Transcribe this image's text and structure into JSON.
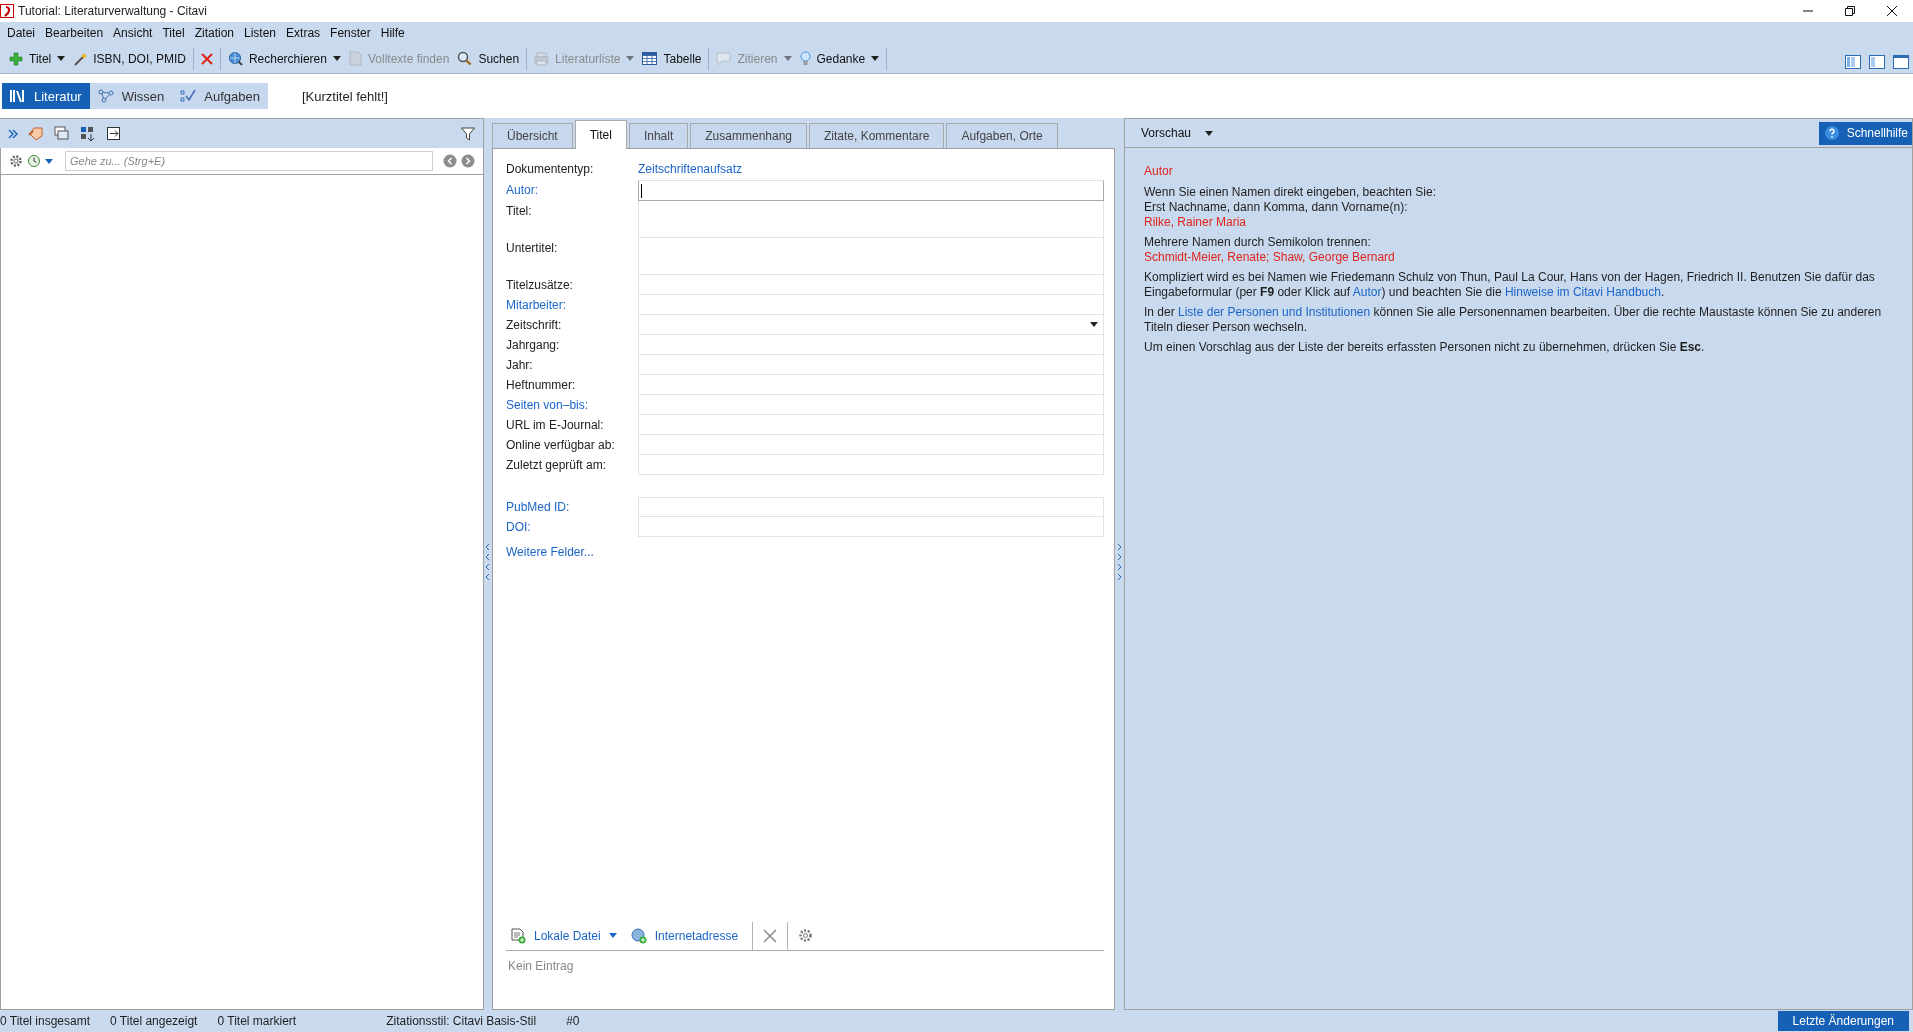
{
  "window": {
    "title": "Tutorial: Literaturverwaltung - Citavi"
  },
  "menu": [
    "Datei",
    "Bearbeiten",
    "Ansicht",
    "Titel",
    "Zitation",
    "Listen",
    "Extras",
    "Fenster",
    "Hilfe"
  ],
  "toolbar": {
    "groups": [
      [
        {
          "label": "Titel",
          "kind": "dropdown",
          "disabled": false
        },
        {
          "label": "ISBN, DOI, PMID",
          "kind": "button",
          "disabled": false
        }
      ],
      [
        {
          "kind": "icon",
          "disabled": false
        }
      ],
      [
        {
          "label": "Recherchieren",
          "kind": "dropdown",
          "disabled": false
        },
        {
          "label": "Volltexte finden",
          "kind": "button",
          "disabled": true
        },
        {
          "label": "Suchen",
          "kind": "button",
          "disabled": false
        }
      ],
      [
        {
          "label": "Literaturliste",
          "kind": "dropdown",
          "disabled": true
        },
        {
          "label": "Tabelle",
          "kind": "button",
          "disabled": false
        }
      ],
      [
        {
          "label": "Zitieren",
          "kind": "dropdown",
          "disabled": true
        },
        {
          "label": "Gedanke",
          "kind": "dropdown",
          "disabled": false
        }
      ]
    ]
  },
  "modes": [
    {
      "label": "Literatur",
      "selected": true
    },
    {
      "label": "Wissen",
      "selected": false
    },
    {
      "label": "Aufgaben",
      "selected": false
    }
  ],
  "short_title": "[Kurztitel fehlt!]",
  "left_pane": {
    "search": {
      "placeholder": "Gehe zu... (Strg+E)"
    }
  },
  "tabs": [
    {
      "label": "Übersicht",
      "selected": false
    },
    {
      "label": "Titel",
      "selected": true
    },
    {
      "label": "Inhalt",
      "selected": false
    },
    {
      "label": "Zusammenhang",
      "selected": false
    },
    {
      "label": "Zitate, Kommentare",
      "selected": false
    },
    {
      "label": "Aufgaben, Orte",
      "selected": false
    }
  ],
  "form": {
    "document_type": {
      "label": "Dokumententyp:",
      "value": "Zeitschriftenaufsatz"
    },
    "fields": [
      {
        "label": "Autor:",
        "link": true,
        "kind": "text",
        "focused": true
      },
      {
        "label": "Titel:",
        "link": false,
        "kind": "multiline",
        "focused": false
      },
      {
        "label": "Untertitel:",
        "link": false,
        "kind": "multiline",
        "focused": false
      },
      {
        "label": "Titelzusätze:",
        "link": false,
        "kind": "text",
        "focused": false
      },
      {
        "label": "Mitarbeiter:",
        "link": true,
        "kind": "text",
        "focused": false
      },
      {
        "label": "Zeitschrift:",
        "link": false,
        "kind": "dropdown",
        "focused": false
      },
      {
        "label": "Jahrgang:",
        "link": false,
        "kind": "text",
        "focused": false
      },
      {
        "label": "Jahr:",
        "link": false,
        "kind": "text",
        "focused": false
      },
      {
        "label": "Heftnummer:",
        "link": false,
        "kind": "text",
        "focused": false
      },
      {
        "label": "Seiten von–bis:",
        "link": true,
        "kind": "text",
        "focused": false
      },
      {
        "label": "URL im E-Journal:",
        "link": false,
        "kind": "text",
        "focused": false
      },
      {
        "label": "Online verfügbar ab:",
        "link": false,
        "kind": "text",
        "focused": false
      },
      {
        "label": "Zuletzt geprüft am:",
        "link": false,
        "kind": "text",
        "focused": false
      }
    ],
    "id_fields": [
      {
        "label": "PubMed ID:",
        "link": true,
        "kind": "text",
        "focused": false
      },
      {
        "label": "DOI:",
        "link": true,
        "kind": "text",
        "focused": false
      }
    ],
    "more": "Weitere Felder..."
  },
  "attachments": {
    "items": [
      {
        "label": "Lokale Datei",
        "kind": "dropdown"
      },
      {
        "label": "Internetadresse",
        "kind": "button"
      }
    ],
    "empty": "Kein Eintrag"
  },
  "preview": {
    "view": "Vorschau",
    "help_button": "Schnellhilfe",
    "heading": "Autor",
    "paragraphs": [
      {
        "lines": [
          {
            "kind": "text",
            "segments": [
              {
                "text": "Wenn Sie einen Namen direkt eingeben, beachten Sie:",
                "link": false
              }
            ]
          },
          {
            "kind": "text",
            "segments": [
              {
                "text": "Erst Nachname, dann Komma, dann Vorname(n):",
                "link": false
              }
            ]
          },
          {
            "kind": "example",
            "segments": [
              {
                "text": "Rilke, Rainer Maria",
                "link": false
              }
            ]
          }
        ]
      },
      {
        "lines": [
          {
            "kind": "text",
            "segments": [
              {
                "text": "Mehrere Namen durch Semikolon trennen:",
                "link": false
              }
            ]
          },
          {
            "kind": "example",
            "segments": [
              {
                "text": "Schmidt-Meier, Renate; Shaw, George Bernard",
                "link": false
              }
            ]
          }
        ]
      },
      {
        "lines": [
          {
            "kind": "text",
            "segments": [
              {
                "text": "Kompliziert wird es bei Namen wie Friedemann Schulz von Thun, Paul La Cour, Hans von der Hagen, Friedrich II. Benutzen Sie dafür das Eingabeformular (per **F9** oder Klick auf ",
                "link": false
              },
              {
                "text": "Autor",
                "link": true
              },
              {
                "text": ") und beachten Sie die ",
                "link": false
              },
              {
                "text": "Hinweise im Citavi Handbuch",
                "link": true
              },
              {
                "text": ".",
                "link": false
              }
            ]
          }
        ]
      },
      {
        "lines": [
          {
            "kind": "text",
            "segments": [
              {
                "text": "In der ",
                "link": false
              },
              {
                "text": "Liste der Personen und Institutionen",
                "link": true
              },
              {
                "text": " können Sie alle Personennamen bearbeiten. Über die rechte Maustaste können Sie zu anderen Titeln dieser Person wechseln.",
                "link": false
              }
            ]
          }
        ]
      },
      {
        "lines": [
          {
            "kind": "text",
            "segments": [
              {
                "text": "Um einen Vorschlag aus der Liste der bereits erfassten Personen nicht zu übernehmen, drücken Sie **Esc**.",
                "link": false
              }
            ]
          }
        ]
      }
    ]
  },
  "status_bar": {
    "counts": [
      "0 Titel insgesamt",
      "0 Titel angezeigt",
      "0 Titel markiert"
    ],
    "citation_style": "Zitationsstil: Citavi Basis-Stil",
    "record": "#0",
    "button": "Letzte Änderungen"
  }
}
